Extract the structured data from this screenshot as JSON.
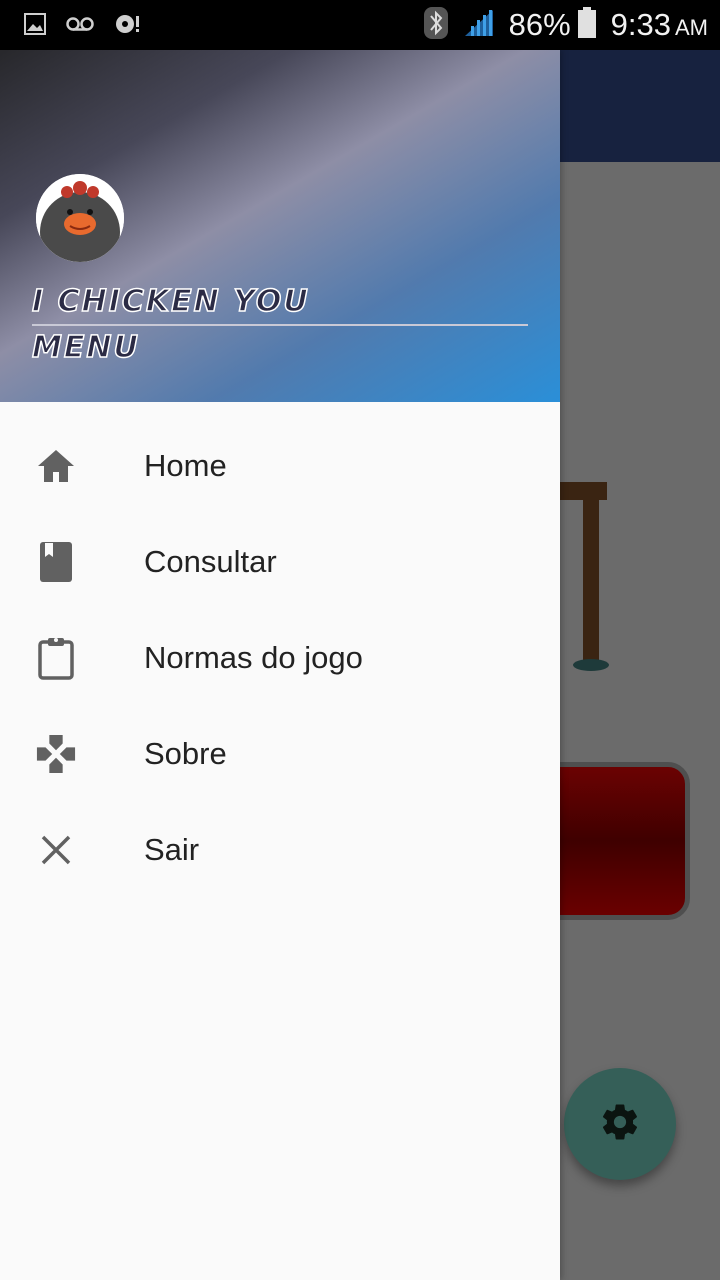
{
  "status_bar": {
    "battery": "86%",
    "time": "9:33",
    "ampm": "AM",
    "icons": [
      "image-notification-icon",
      "voicemail-icon",
      "sync-alert-icon",
      "bluetooth-icon",
      "signal-icon",
      "battery-icon"
    ]
  },
  "drawer": {
    "header": {
      "title": "I CHICKEN YOU",
      "subtitle": "MENU"
    },
    "items": [
      {
        "label": "Home",
        "icon": "home-icon"
      },
      {
        "label": "Consultar",
        "icon": "book-icon"
      },
      {
        "label": "Normas do jogo",
        "icon": "clipboard-icon"
      },
      {
        "label": "Sobre",
        "icon": "gamepad-icon"
      },
      {
        "label": "Sair",
        "icon": "close-icon"
      }
    ]
  },
  "colors": {
    "drawer_bg": "#fafafa",
    "icon_gray": "#616161",
    "fab": "#355f58",
    "toolbar": "#17223f"
  }
}
